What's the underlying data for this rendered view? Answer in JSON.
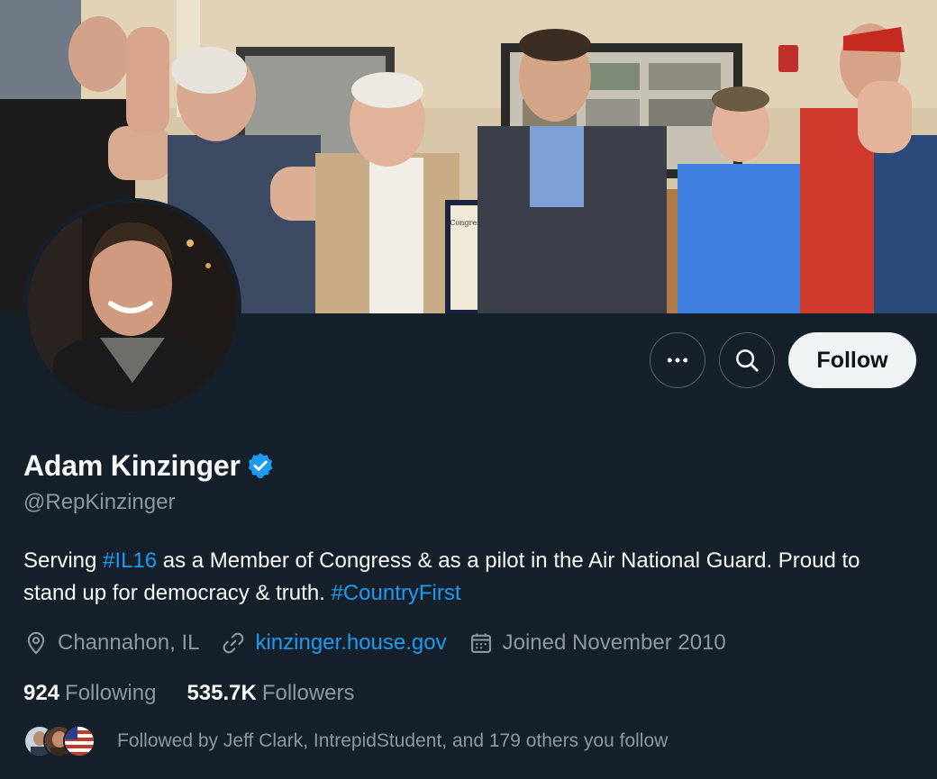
{
  "profile": {
    "display_name": "Adam Kinzinger",
    "handle": "@RepKinzinger",
    "bio_part1": "Serving ",
    "bio_hashtag1": "#IL16",
    "bio_part2": " as a Member of Congress & as a pilot in the Air National Guard. Proud to stand up for democracy & truth. ",
    "bio_hashtag2": "#CountryFirst",
    "location": "Channahon, IL",
    "website": "kinzinger.house.gov",
    "joined": "Joined November 2010",
    "following_count": "924",
    "following_label": "Following",
    "followers_count": "535.7K",
    "followers_label": "Followers",
    "followed_by": "Followed by Jeff Clark, IntrepidStudent, and 179 others you follow"
  },
  "actions": {
    "follow_label": "Follow"
  },
  "banner": {
    "document_heading": "Congressional Record"
  },
  "icons": {
    "more": "more-icon",
    "search": "search-icon",
    "verified": "verified-badge-icon",
    "location": "location-pin-icon",
    "link": "link-icon",
    "calendar": "calendar-icon"
  },
  "colors": {
    "background": "#15202b",
    "accent": "#1d9bf0",
    "secondary_text": "#8b98a5",
    "follow_button": "#eff3f4"
  }
}
